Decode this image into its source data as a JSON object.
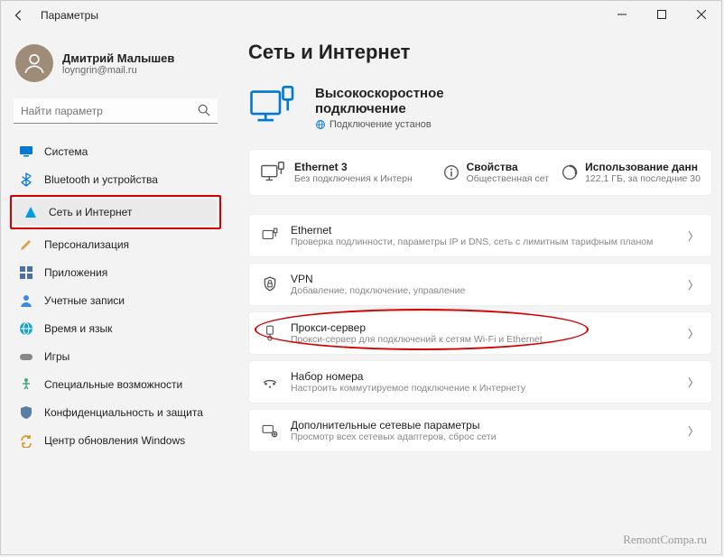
{
  "window": {
    "title": "Параметры"
  },
  "user": {
    "name": "Дмитрий Малышев",
    "email": "loyngrin@mail.ru"
  },
  "search": {
    "placeholder": "Найти параметр"
  },
  "sidebar": {
    "items": [
      {
        "label": "Система"
      },
      {
        "label": "Bluetooth и устройства"
      },
      {
        "label": "Сеть и Интернет"
      },
      {
        "label": "Персонализация"
      },
      {
        "label": "Приложения"
      },
      {
        "label": "Учетные записи"
      },
      {
        "label": "Время и язык"
      },
      {
        "label": "Игры"
      },
      {
        "label": "Специальные возможности"
      },
      {
        "label": "Конфиденциальность и защита"
      },
      {
        "label": "Центр обновления Windows"
      }
    ]
  },
  "main": {
    "heading": "Сеть и Интернет",
    "hero": {
      "l1": "Высокоскоростное",
      "l2": "подключение",
      "status": "Подключение установ"
    },
    "status": {
      "eth_title": "Ethernet 3",
      "eth_sub": "Без подключения к Интерн",
      "props_title": "Свойства",
      "props_sub": "Общественная сет",
      "usage_title": "Использование данн",
      "usage_sub": "122,1 ГБ, за последние 30"
    },
    "cards": {
      "ethernet": {
        "title": "Ethernet",
        "sub": "Проверка подлинности, параметры IP и DNS, сеть с лимитным тарифным планом"
      },
      "vpn": {
        "title": "VPN",
        "sub": "Добавление, подключение, управление"
      },
      "proxy": {
        "title": "Прокси-сервер",
        "sub": "Прокси-сервер для подключений к сетям Wi-Fi и Ethernet"
      },
      "dial": {
        "title": "Набор номера",
        "sub": "Настроить коммутируемое подключение к Интернету"
      },
      "adv": {
        "title": "Дополнительные сетевые параметры",
        "sub": "Просмотр всех сетевых адаптеров, сброс сети"
      }
    }
  },
  "watermark": "RemontCompa.ru"
}
